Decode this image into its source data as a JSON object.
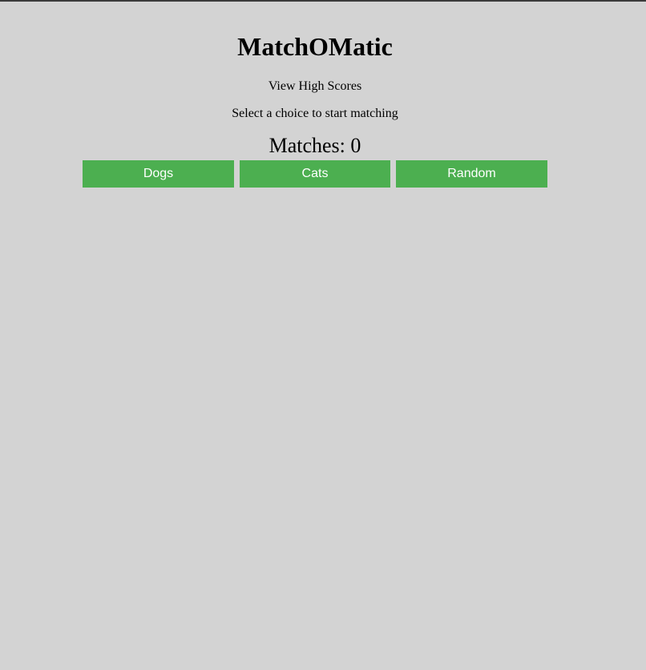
{
  "app": {
    "title": "MatchOMatic"
  },
  "links": {
    "high_scores": "View High Scores"
  },
  "instructions": "Select a choice to start matching",
  "matches": {
    "label": "Matches: 0"
  },
  "choices": [
    {
      "label": "Dogs"
    },
    {
      "label": "Cats"
    },
    {
      "label": "Random"
    }
  ],
  "colors": {
    "background": "#d3d3d3",
    "button": "#4caf50",
    "button_text": "#ffffff"
  }
}
